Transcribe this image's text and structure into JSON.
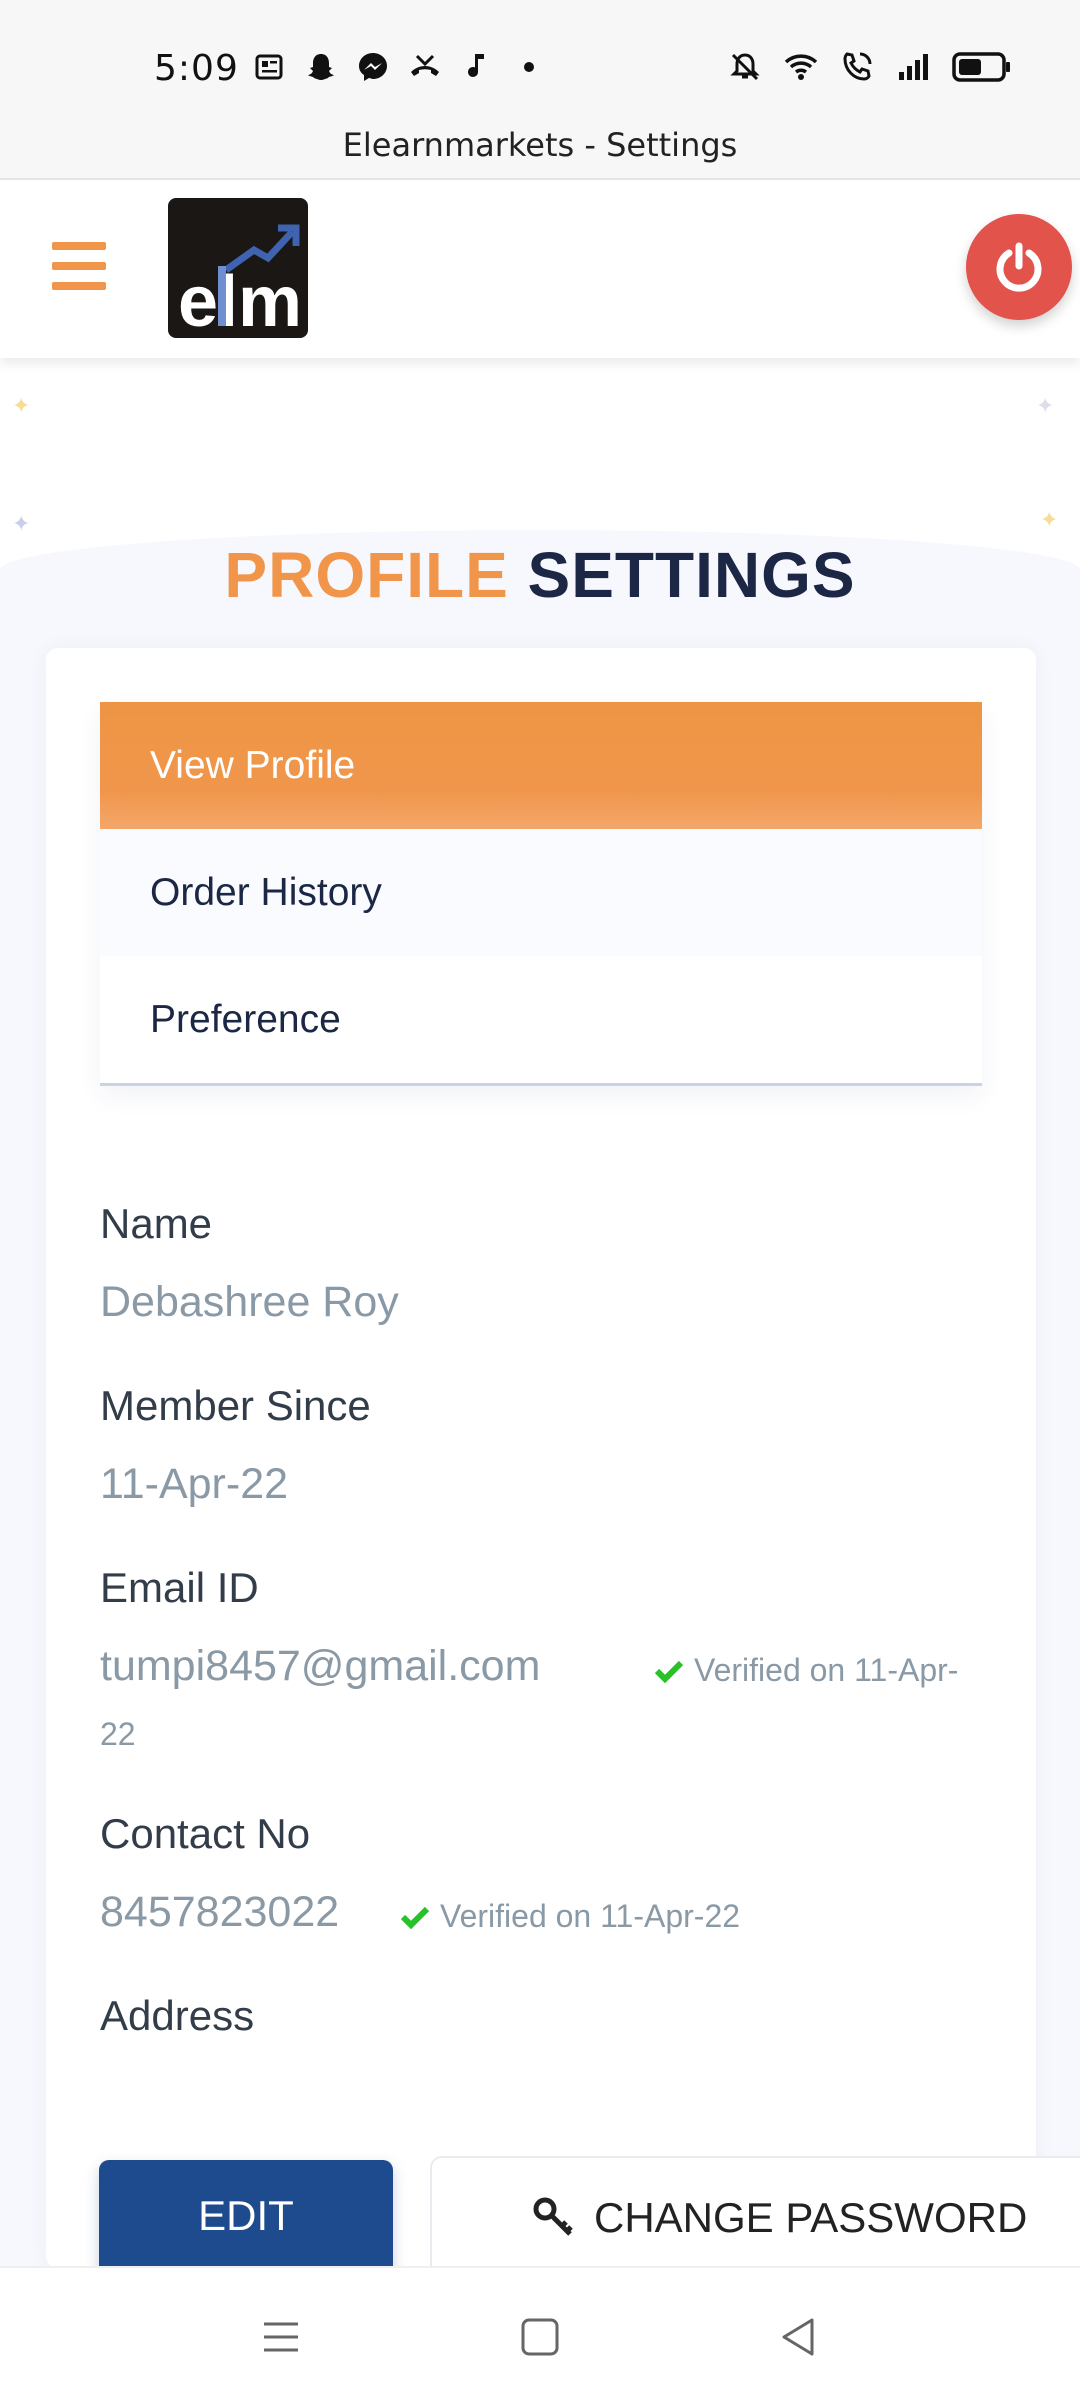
{
  "status_bar": {
    "time": "5:09",
    "left_icons": [
      "news-icon",
      "snapchat-icon",
      "messenger-icon",
      "missed-call-icon",
      "music-note-icon",
      "dot-icon"
    ],
    "right_icons": [
      "mute-icon",
      "wifi-icon",
      "wifi-call-icon",
      "signal-icon",
      "battery-icon"
    ]
  },
  "app_title": "Elearnmarkets - Settings",
  "header": {
    "menu_icon": "hamburger-icon",
    "logo_text": "elm",
    "power_icon": "power-icon",
    "accent_color": "#f0954a",
    "power_color": "#e2534b"
  },
  "page_title": {
    "part1": "PROFILE",
    "part2": "SETTINGS"
  },
  "menu": {
    "items": [
      {
        "label": "View Profile",
        "active": true
      },
      {
        "label": "Order History",
        "active": false
      },
      {
        "label": "Preference",
        "active": false
      }
    ]
  },
  "profile": {
    "name_label": "Name",
    "name_value": "Debashree Roy",
    "member_label": "Member Since",
    "member_value": "11-Apr-22",
    "email_label": "Email ID",
    "email_value": "tumpi8457@gmail.com",
    "email_verified_1": "Verified on 11-Apr-",
    "email_verified_2": "22",
    "contact_label": "Contact No",
    "contact_value": "8457823022",
    "contact_verified": "Verified on 11-Apr-22",
    "address_label": "Address"
  },
  "actions": {
    "edit": "EDIT",
    "change_password": "CHANGE PASSWORD",
    "edit_color": "#1e4b8e"
  },
  "nav": {
    "recents": "recents-icon",
    "home": "home-icon",
    "back": "back-icon"
  }
}
